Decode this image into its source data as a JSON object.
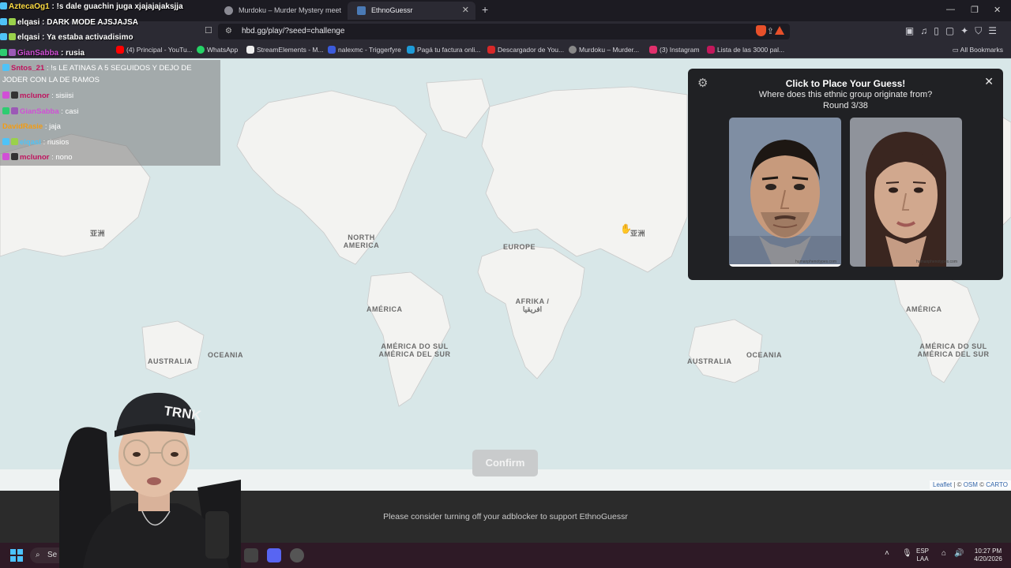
{
  "browser": {
    "tabs": [
      {
        "label": "Murdoku – Murder Mystery meets Su"
      },
      {
        "label": "EthnoGuessr",
        "active": true
      }
    ],
    "url": "hbd.gg/play/?seed=challenge",
    "bookmarks": [
      {
        "label": "(4) Principal - YouTu...",
        "color": "#ff0000"
      },
      {
        "label": "WhatsApp",
        "color": "#25d366"
      },
      {
        "label": "StreamElements - M...",
        "color": "#ffffff"
      },
      {
        "label": "nalexmc - Triggerfyre",
        "color": "#3b5bdb"
      },
      {
        "label": "Pagá tu factura onli...",
        "color": "#1e9bd7"
      },
      {
        "label": "Descargador de You...",
        "color": "#d62828"
      },
      {
        "label": "Murdoku – Murder...",
        "color": "#888888"
      },
      {
        "label": "(3) Instagram",
        "color": "#e1306c"
      },
      {
        "label": "Lista de las 3000 pal...",
        "color": "#c2185b"
      }
    ],
    "all_bookmarks": "All Bookmarks"
  },
  "map": {
    "labels": [
      {
        "text": "亚洲"
      },
      {
        "text": "NORTH AMERICA"
      },
      {
        "text": "EUROPE"
      },
      {
        "text": "亚洲"
      },
      {
        "text": "AMÉRICA"
      },
      {
        "text": "AFRIKA / افريقيا"
      },
      {
        "text": "AMÉRICA"
      },
      {
        "text": "AUSTRALIA"
      },
      {
        "text": "OCEANIA"
      },
      {
        "text": "AMÉRICA DO SUL AMÉRICA DEL SUR"
      },
      {
        "text": "AUSTRALIA"
      },
      {
        "text": "OCEANIA"
      },
      {
        "text": "AMÉRICA DO SUL AMÉRICA DEL SUR"
      }
    ],
    "attribution": {
      "leaflet": "Leaflet",
      "sep": " | © ",
      "osm": "OSM",
      "carto": "CARTO"
    },
    "confirm_label": "Confirm"
  },
  "panel": {
    "title": "Click to Place Your Guess!",
    "question": "Where does this ethnic group originate from?",
    "round": "Round 3/38",
    "close": "✕",
    "watermark": "humanphenotypes.com"
  },
  "ad_message": "Please consider turning off your adblocker to support EthnoGuessr",
  "taskbar": {
    "search": "Se",
    "lang": "ESP",
    "region": "LAA",
    "time": "10:27 PM",
    "date": "4/20/2026"
  },
  "chat": {
    "top_lines": [
      {
        "user": "AztecaOg1",
        "text": " : !s dale guachin juga xjajajajaksjja",
        "color": "#ffdd44"
      },
      {
        "user": "elqasi",
        "text": " : DARK MODE AJSJAJSA",
        "color": "#ffffff"
      },
      {
        "user": "elqasi",
        "text": " : Ya estaba activadisimo",
        "color": "#ffffff"
      },
      {
        "user": "GianSabba",
        "text": " : rusia",
        "color": "#d14fd6"
      }
    ],
    "box_lines": [
      {
        "user": "Sntos_21",
        "text": " : !s LE ATINAS A 5 SEGUIDOS Y DEJO DE",
        "color": "#c0135e"
      },
      {
        "user": "",
        "text": "JODER CON LA DE RAMOS",
        "color": "#ffffff"
      },
      {
        "user": "mclunor",
        "text": " : sisiisi",
        "color": "#c0135e"
      },
      {
        "user": "GianSabba",
        "text": " : casi",
        "color": "#d14fd6"
      },
      {
        "user": "DavidRasie",
        "text": " : jaja",
        "color": "#f39c12"
      },
      {
        "user": "elqasi",
        "text": " : riusios",
        "color": "#4fc3f7"
      },
      {
        "user": "mclunor",
        "text": " : nono",
        "color": "#c0135e"
      }
    ]
  }
}
